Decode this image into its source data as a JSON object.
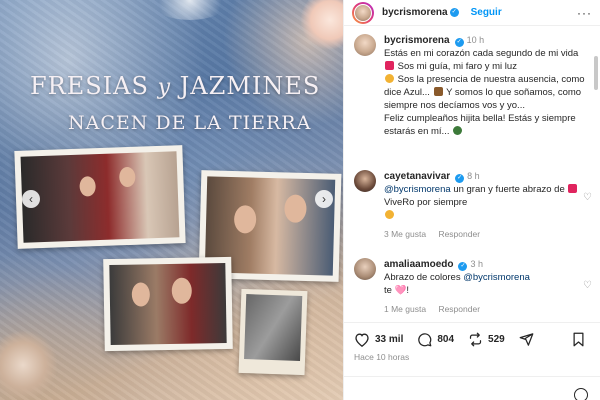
{
  "image": {
    "title_line1a": "FRESIAS",
    "title_line1b": "y",
    "title_line1c": "JAZMINES",
    "title_line2": "NACEN DE LA TIERRA"
  },
  "header": {
    "username": "bycrismorena",
    "follow_label": "Seguir",
    "more_label": "···"
  },
  "caption": {
    "username": "bycrismorena",
    "time": "10 h",
    "text_1": "Estás en mi corazón cada segundo de mi vida",
    "text_2": "Sos mi guía, mi faro y mi luz",
    "text_3": "Sos la presencia de nuestra ausencia, como dice Azul...",
    "text_4": "Y somos lo que soñamos, como siempre nos decíamos vos y yo...",
    "text_5": "Feliz cumpleaños hijita bella! Estás y siempre estarás en mí..."
  },
  "comments": [
    {
      "username": "cayetanavivar",
      "time": "8 h",
      "mention": "@bycrismorena",
      "text_a": "un gran y fuerte abrazo de",
      "text_b": "ViveRo por siempre",
      "likes": "3 Me gusta",
      "reply": "Responder"
    },
    {
      "username": "amaliaamoedo",
      "time": "3 h",
      "text_a": "Abrazo de colores",
      "mention": "@bycrismorena",
      "text_b": "te 🩷!",
      "likes": "1 Me gusta",
      "reply": "Responder"
    }
  ],
  "actions": {
    "likes": "33 mil",
    "comments": "804",
    "reposts": "529",
    "posted": "Hace 10 horas"
  },
  "colors": {
    "accent": "#0095f6",
    "heart": "#e0245e",
    "verified": "#1d9bf0"
  }
}
